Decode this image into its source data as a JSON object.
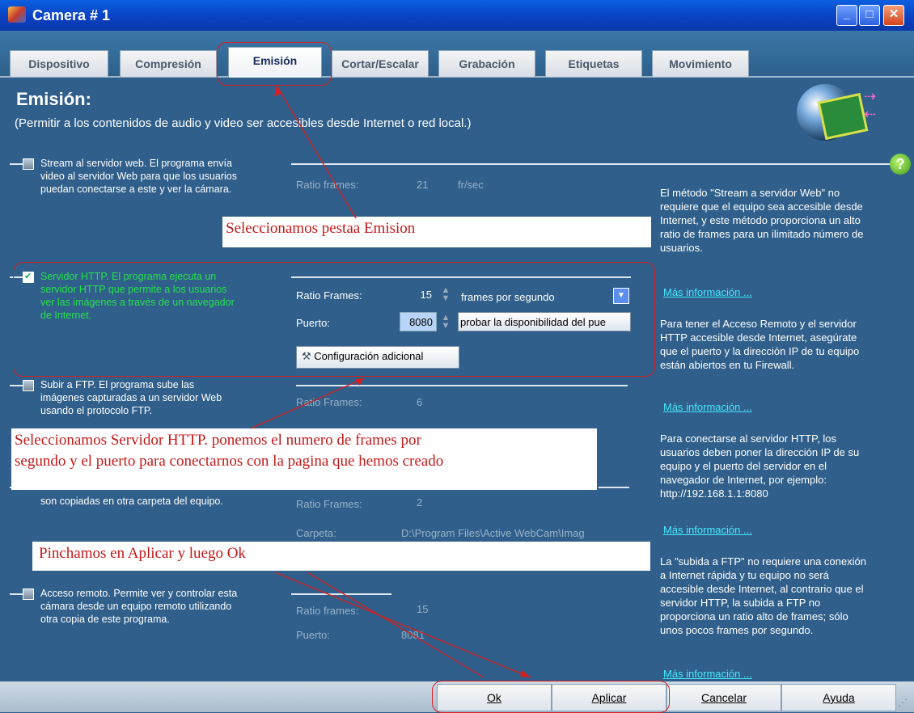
{
  "window": {
    "title": "Camera # 1",
    "min": "_",
    "max": "□",
    "close": "✕"
  },
  "tabs": [
    "Dispositivo",
    "Compresión",
    "Emisión",
    "Cortar/Escalar",
    "Grabación",
    "Etiquetas",
    "Movimiento"
  ],
  "page": {
    "title": "Emisión:",
    "subtitle": "(Permitir a los contenidos de audio y video ser accesibles desde Internet o red local.)"
  },
  "sections": {
    "stream": {
      "desc_lines": [
        "Stream al servidor web. El programa envía",
        "video al servidor Web para que los usuarios",
        "puedan conectarse a este y ver la cámara."
      ],
      "ratio_label": "Ratio frames:",
      "ratio_value": "21",
      "ratio_unit": "fr/sec"
    },
    "http": {
      "desc_lines": [
        "Servidor HTTP. El programa ejecuta un",
        "servidor HTTP que permite a los usuarios",
        "ver las imágenes a través de un navegador",
        "de Internet."
      ],
      "ratio_label": "Ratio Frames:",
      "ratio_value": "15",
      "ratio_unit": "frames por segundo",
      "port_label": "Puerto:",
      "port_value": "8080",
      "probe_button": "probar la disponibilidad del pue",
      "config_button": "Configuración adicional"
    },
    "ftp": {
      "desc_lines": [
        "Subir a FTP. El programa sube las",
        "imágenes capturadas a un servidor Web",
        "usando el protocolo FTP."
      ],
      "ratio_label": "Ratio Frames:",
      "ratio_value": "6"
    },
    "copy": {
      "desc_lines": [
        "son copiadas en otra carpeta del equipo."
      ],
      "ratio_label": "Ratio Frames:",
      "ratio_value": "2",
      "folder_label": "Carpeta:",
      "folder_value": "D:\\Program Files\\Active WebCam\\Imag"
    },
    "remote": {
      "desc_lines": [
        "Acceso remoto. Permite ver y controlar esta",
        "cámara desde un equipo remoto utilizando",
        "otra copia de este programa."
      ],
      "ratio_label": "Ratio frames:",
      "ratio_value": "15",
      "port_label": "Puerto:",
      "port_value": "8081"
    }
  },
  "help": {
    "p1": [
      "El método \"Stream a servidor Web\" no",
      "requiere que el equipo sea accesible desde",
      "Internet, y este método proporciona un alto",
      "ratio de frames para un ilimitado número de",
      "usuarios."
    ],
    "p2": [
      "Para tener el Acceso Remoto y el servidor",
      "HTTP accesible desde Internet, asegúrate",
      "que el puerto y la dirección IP de tu equipo",
      "están abiertos en tu Firewall."
    ],
    "p3": [
      "Para conectarse al servidor HTTP, los",
      "usuarios deben poner la dirección IP de su",
      "equipo y el puerto del servidor en el",
      "navegador de Internet, por ejemplo:",
      "http://192.168.1.1:8080"
    ],
    "p4": [
      "La \"subida a FTP\" no requiere una conexión",
      "a Internet rápida y tu equipo no será",
      "accesible desde Internet, al contrario que el",
      "servidor HTTP, la subida a FTP no",
      "proporciona un ratio alto de frames; sólo",
      "unos pocos frames por segundo."
    ],
    "link": "Más información ...",
    "q": "?"
  },
  "annotations": {
    "tab_note": "Seleccionamos pestaa Emision",
    "http_note_lines": [
      "Seleccionamos Servidor HTTP. ponemos el numero de frames por",
      "segundo y el puerto para conectarnos con la pagina que hemos creado"
    ],
    "apply_note": "Pinchamos en Aplicar y luego Ok"
  },
  "buttons": {
    "ok": "Ok",
    "apply": "Aplicar",
    "cancel": "Cancelar",
    "help": "Ayuda"
  },
  "colors": {
    "accent": "#2f5f8a",
    "green_text": "#26e24a",
    "link": "#46e8ff",
    "annotation": "#c41818"
  }
}
